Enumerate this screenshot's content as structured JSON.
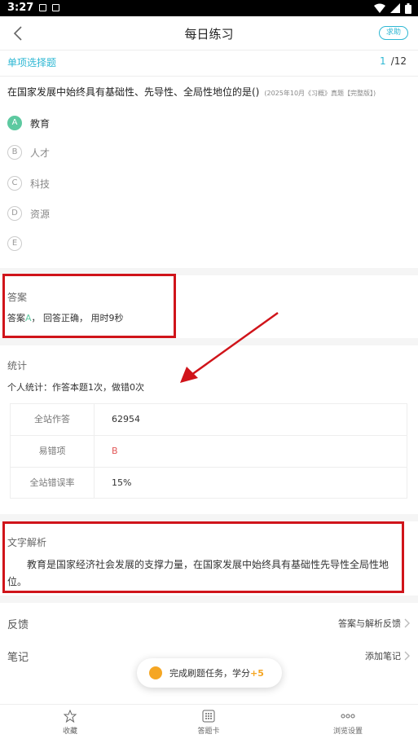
{
  "status_bar": {
    "time": "3:27"
  },
  "header": {
    "title": "每日练习",
    "help_label": "求助"
  },
  "question": {
    "type_label": "单项选择题",
    "current": "1",
    "total": "/12",
    "text": "在国家发展中始终具有基础性、先导性、全局性地位的是()",
    "source": "(2025年10月《习概》真题【完整版】)",
    "options": [
      {
        "key": "A",
        "text": "教育",
        "selected": true
      },
      {
        "key": "B",
        "text": "人才"
      },
      {
        "key": "C",
        "text": "科技"
      },
      {
        "key": "D",
        "text": "资源"
      },
      {
        "key": "E",
        "text": ""
      }
    ]
  },
  "answer": {
    "title": "答案",
    "prefix": "答案",
    "key": "A",
    "suffix": "， 回答正确， 用时9秒"
  },
  "stats": {
    "title": "统计",
    "personal": "个人统计：作答本题1次，做错0次",
    "rows": [
      {
        "label": "全站作答",
        "value": "62954"
      },
      {
        "label": "易错项",
        "value": "B"
      },
      {
        "label": "全站错误率",
        "value": "15%"
      }
    ]
  },
  "analysis": {
    "title": "文字解析",
    "text": "教育是国家经济社会发展的支撑力量，在国家发展中始终具有基础性先导性全局性地位。"
  },
  "feedback": {
    "label": "反馈",
    "action": "答案与解析反馈"
  },
  "notes": {
    "label": "笔记",
    "action": "添加笔记"
  },
  "toast": {
    "text": "完成刷题任务，学分",
    "points": "+5"
  },
  "tabbar": [
    {
      "label": "收藏",
      "icon": "star-icon"
    },
    {
      "label": "答题卡",
      "icon": "grid-icon"
    },
    {
      "label": "浏览设置",
      "icon": "more-icon"
    }
  ],
  "colors": {
    "accent": "#2db7d3",
    "correct": "#5dc9a0",
    "annotation_red": "#d0141a",
    "error_red": "#e25757",
    "points": "#f5a623"
  }
}
